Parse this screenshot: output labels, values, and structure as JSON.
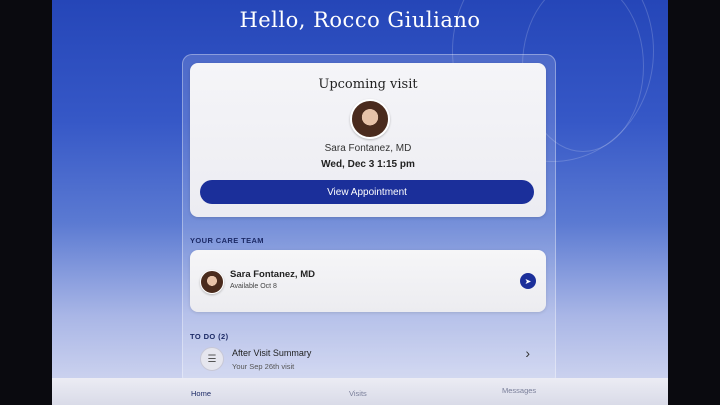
{
  "header": {
    "greeting": "Hello, Rocco Giuliano"
  },
  "upcoming_visit": {
    "title": "Upcoming visit",
    "doctor": "Sara Fontanez, MD",
    "datetime": "Wed, Dec 3 1:15 pm",
    "button_label": "View Appointment"
  },
  "care_team": {
    "section_label": "YOUR CARE TEAM",
    "members": [
      {
        "name": "Sara Fontanez, MD",
        "availability": "Available Oct 8"
      }
    ]
  },
  "todo": {
    "section_label": "TO DO (2)",
    "items": [
      {
        "title": "After Visit Summary",
        "subtitle": "Your Sep 26th visit"
      }
    ]
  },
  "tabs": [
    {
      "label": "Home",
      "active": true
    },
    {
      "label": "Visits",
      "active": false
    },
    {
      "label": "Messages",
      "active": false
    }
  ],
  "colors": {
    "primary": "#1b2f9a",
    "background_top": "#2546b8"
  },
  "icons": [
    "doctor-avatar",
    "send-message-icon",
    "document-icon",
    "chevron-right-icon"
  ]
}
